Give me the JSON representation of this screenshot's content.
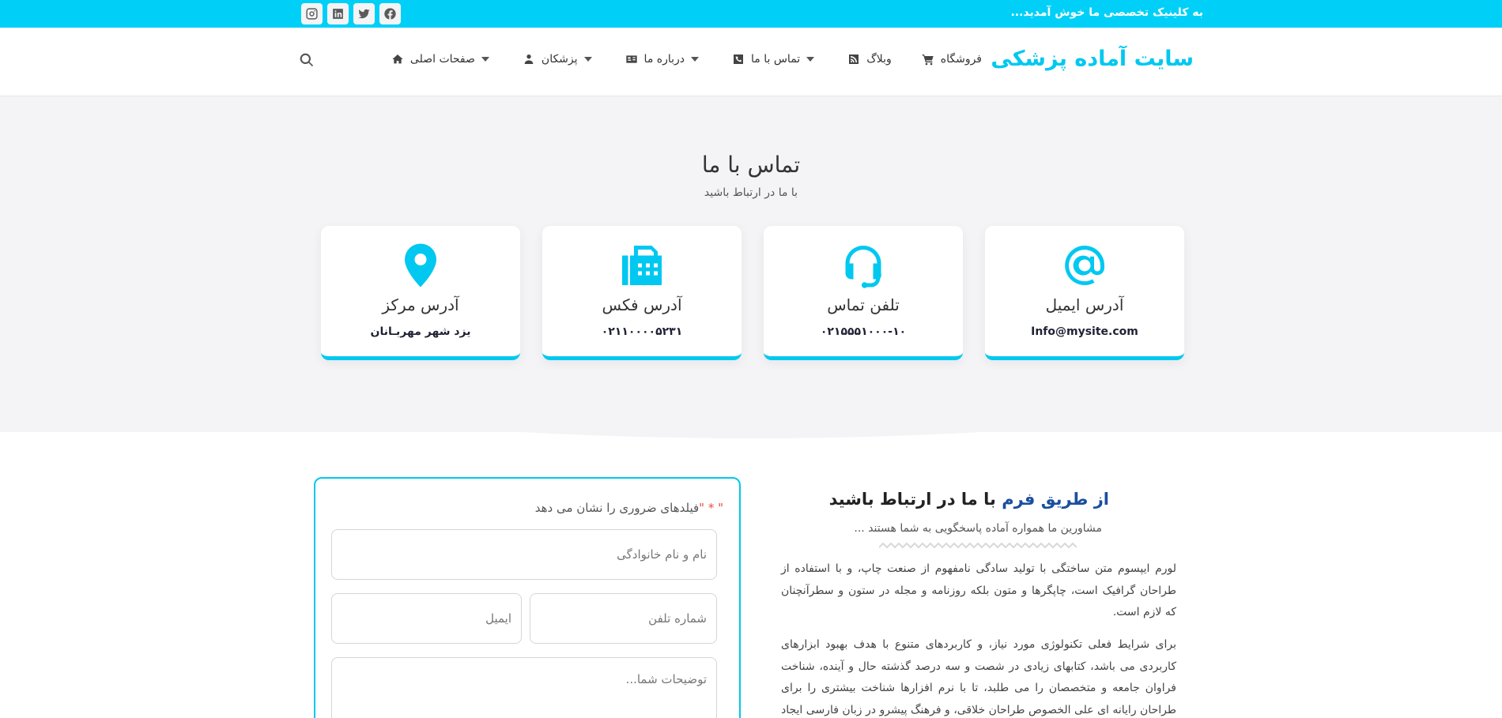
{
  "topbar": {
    "welcome": "به کلینیک تخصصی ما خوش آمدید...",
    "social": [
      {
        "icon": "facebook-icon"
      },
      {
        "icon": "twitter-icon"
      },
      {
        "icon": "linkedin-icon"
      },
      {
        "icon": "instagram-icon"
      }
    ]
  },
  "header": {
    "logo": "سایت آماده پزشکی",
    "nav": [
      {
        "label": "صفحات اصلی",
        "icon": "home-icon",
        "dropdown": true
      },
      {
        "label": "پزشکان",
        "icon": "doctor-icon",
        "dropdown": true
      },
      {
        "label": "درباره ما",
        "icon": "id-card-icon",
        "dropdown": true
      },
      {
        "label": "تماس با ما",
        "icon": "phone-icon",
        "dropdown": true
      },
      {
        "label": "وبلاگ",
        "icon": "rss-icon",
        "dropdown": false
      },
      {
        "label": "فروشگاه",
        "icon": "cart-icon",
        "dropdown": false
      }
    ]
  },
  "hero": {
    "title": "تماس با ما",
    "subtitle": "با ما در ارتباط باشید",
    "cards": [
      {
        "title": "آدرس ایمیل",
        "value": "Info@mysite.com",
        "icon": "at-sign-icon"
      },
      {
        "title": "تلفن تماس",
        "value": "۰۲۱۵۵۵۱۰۰۰-۱۰",
        "icon": "headset-icon"
      },
      {
        "title": "آدرس فکس",
        "value": "۰۲۱۱۰۰۰۰۵۲۳۱",
        "icon": "fax-icon"
      },
      {
        "title": "آدرس مرکز",
        "value": "یزد شهر مهربـانان",
        "icon": "map-pin-icon"
      }
    ]
  },
  "form": {
    "required_note": "فیلدهای ضروری را نشان می دهد",
    "required_mark": "\" * \"",
    "name_placeholder": "نام و نام خانوادگی",
    "phone_placeholder": "شماره تلفن",
    "email_placeholder": "ایمیل",
    "message_placeholder": "توضیحات شما..."
  },
  "content": {
    "heading_highlight": "از طریق فرم",
    "heading_rest": "با ما در ارتباط باشید",
    "subheading": "مشاورین ما همواره آماده پاسخگویی به شما هستند ...",
    "paragraph1": "لورم ایپسوم متن ساختگی با تولید سادگی نامفهوم از صنعت چاپ، و با استفاده از طراحان گرافیک است، چاپگرها و متون بلکه روزنامه و مجله در ستون و سطرآنچنان که لازم است.",
    "paragraph2": "برای شرایط فعلی تکنولوژی مورد نیاز، و کاربردهای متنوع با هدف بهبود ابزارهای کاربردی می باشد، کتابهای زیادی در شصت و سه درصد گذشته حال و آینده، شناخت فراوان جامعه و متخصصان را می طلبد، تا با نرم افزارها شناخت بیشتری را برای طراحان رایانه ای علی الخصوص طراحان خلاقی، و فرهنگ پیشرو در زبان فارسی ایجاد کرد، در"
  },
  "colors": {
    "accent": "#00c8f0",
    "heading_highlight": "#1a4fa0"
  }
}
